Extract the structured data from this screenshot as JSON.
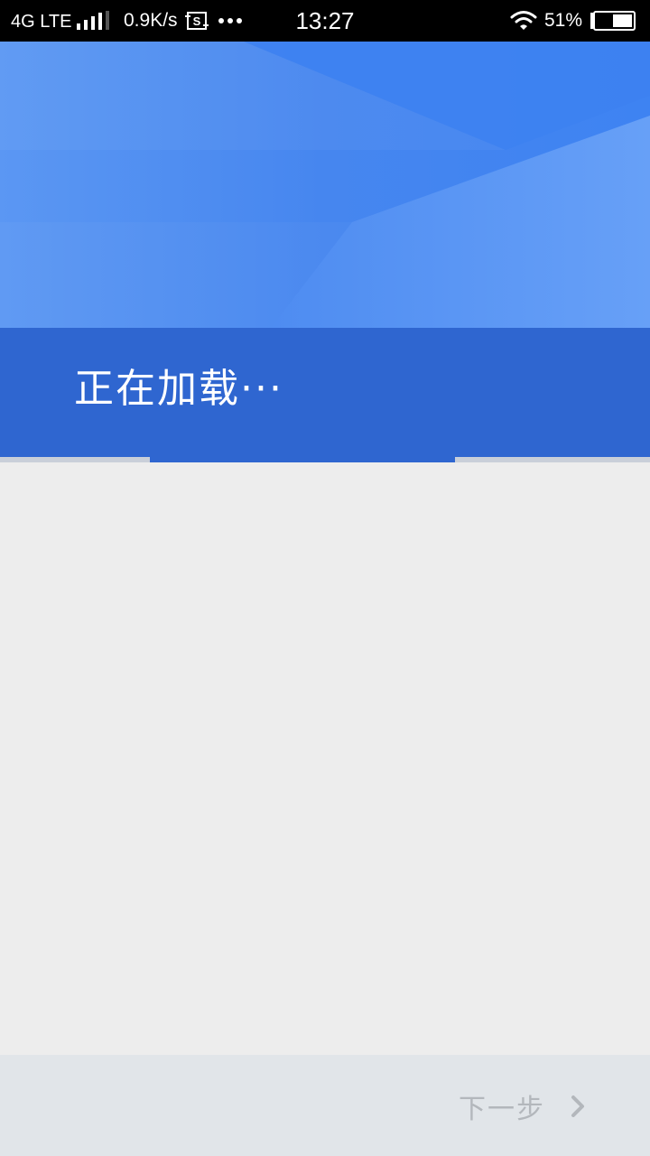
{
  "status_bar": {
    "network": "4G LTE",
    "speed": "0.9K/s",
    "time": "13:27",
    "battery_percent": "51%",
    "icons": [
      "signal-icon",
      "screenshot-icon",
      "more-dots-icon",
      "wifi-icon",
      "battery-icon"
    ]
  },
  "header": {
    "loading_text": "正在加载···",
    "progress": 0.47
  },
  "footer": {
    "next_label": "下一步",
    "next_icon": "chevron-right-icon"
  },
  "colors": {
    "status_bar_bg": "#000000",
    "hero_blue": "#4a8bf0",
    "title_bar_blue": "#2f66d0",
    "content_bg": "#ededed",
    "bottom_bar_bg": "#e1e5e9",
    "disabled_text": "#b3b7bc"
  }
}
